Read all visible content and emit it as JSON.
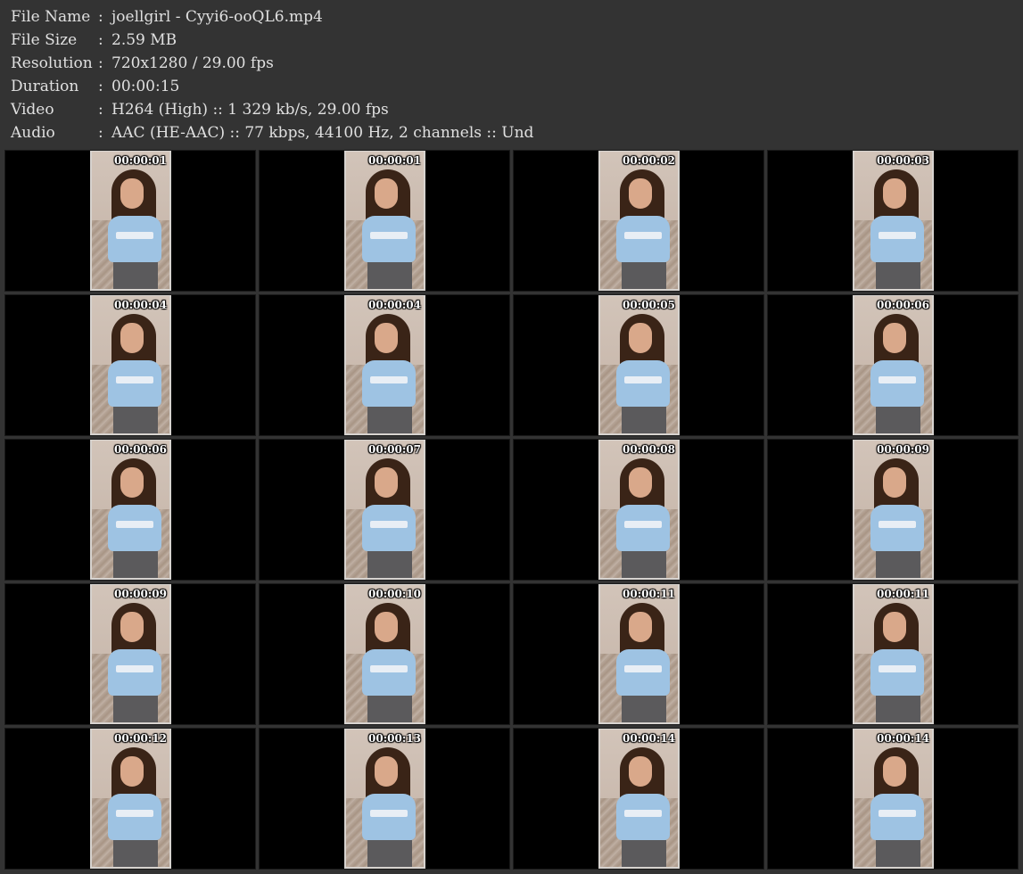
{
  "info": [
    {
      "key": "File Name",
      "sep": ":",
      "value": "joellgirl - Cyyi6-ooQL6.mp4"
    },
    {
      "key": "File Size",
      "sep": ":",
      "value": "2.59 MB"
    },
    {
      "key": "Resolution",
      "sep": ":",
      "value": "720x1280 / 29.00 fps"
    },
    {
      "key": "Duration",
      "sep": ":",
      "value": "00:00:15"
    },
    {
      "key": "Video",
      "sep": ":",
      "value": "H264 (High) :: 1 329 kb/s, 29.00 fps"
    },
    {
      "key": "Audio",
      "sep": ":",
      "value": "AAC (HE-AAC) :: 77 kbps, 44100 Hz, 2 channels :: Und"
    }
  ],
  "thumbnails": [
    {
      "time": "00:00:01"
    },
    {
      "time": "00:00:01"
    },
    {
      "time": "00:00:02"
    },
    {
      "time": "00:00:03"
    },
    {
      "time": "00:00:04"
    },
    {
      "time": "00:00:04"
    },
    {
      "time": "00:00:05"
    },
    {
      "time": "00:00:06"
    },
    {
      "time": "00:00:06"
    },
    {
      "time": "00:00:07"
    },
    {
      "time": "00:00:08"
    },
    {
      "time": "00:00:09"
    },
    {
      "time": "00:00:09"
    },
    {
      "time": "00:00:10"
    },
    {
      "time": "00:00:11"
    },
    {
      "time": "00:00:11"
    },
    {
      "time": "00:00:12"
    },
    {
      "time": "00:00:13"
    },
    {
      "time": "00:00:14"
    },
    {
      "time": "00:00:14"
    }
  ]
}
